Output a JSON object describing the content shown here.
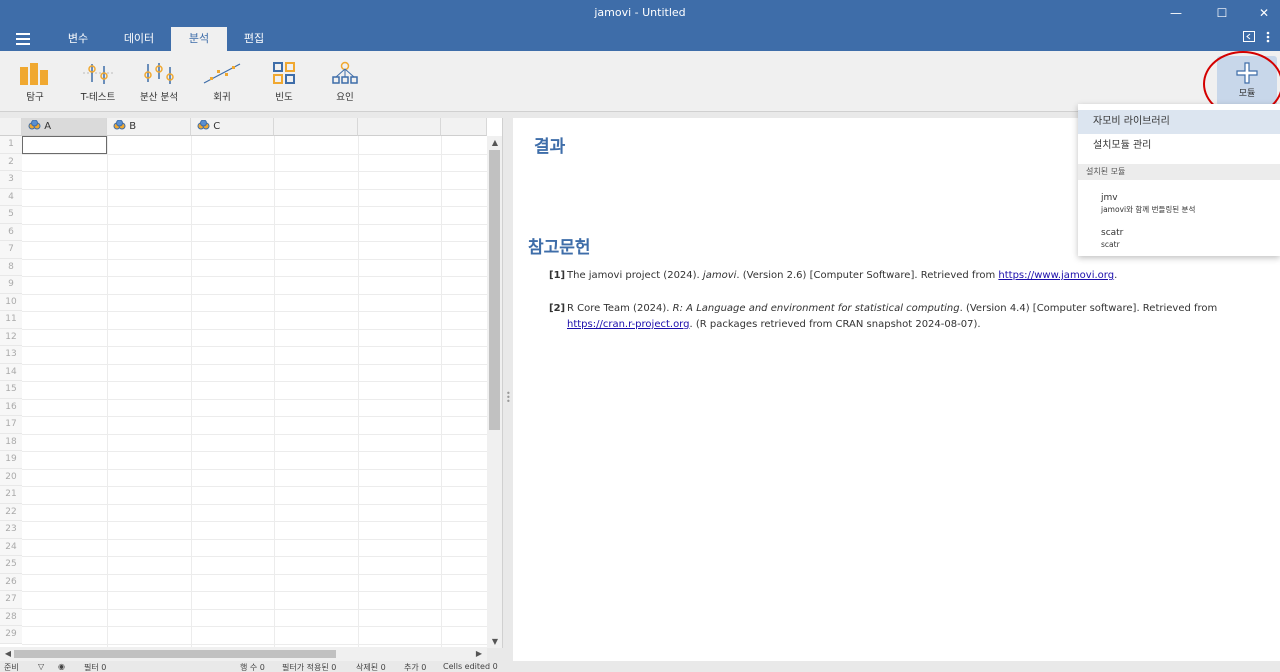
{
  "window": {
    "title": "jamovi - Untitled",
    "minimize": "—",
    "maximize": "☐",
    "close": "✕"
  },
  "tabs": [
    {
      "label": "변수"
    },
    {
      "label": "데이터"
    },
    {
      "label": "분석"
    },
    {
      "label": "편집"
    }
  ],
  "ribbon": {
    "explore": "탐구",
    "ttest": "T-테스트",
    "anova": "분산 분석",
    "regression": "회귀",
    "frequencies": "빈도",
    "factor": "요인",
    "modules": "모듈"
  },
  "sheet": {
    "columns": [
      "A",
      "B",
      "C"
    ],
    "rows": [
      "1",
      "2",
      "3",
      "4",
      "5",
      "6",
      "7",
      "8",
      "9",
      "10",
      "11",
      "12",
      "13",
      "14",
      "15",
      "16",
      "17",
      "18",
      "19",
      "20",
      "21",
      "22",
      "23",
      "24",
      "25",
      "26",
      "27",
      "28",
      "29"
    ]
  },
  "results": {
    "title": "결과",
    "references_title": "참고문헌",
    "ref1": {
      "num": "[1]",
      "pre": "The jamovi project (2024). ",
      "italic": "jamovi",
      "post": ". (Version 2.6) [Computer Software]. Retrieved from ",
      "link": "https://www.jamovi.org",
      "end": "."
    },
    "ref2": {
      "num": "[2]",
      "pre": "R Core Team (2024). ",
      "italic": "R: A Language and environment for statistical computing",
      "post": ". (Version 4.4) [Computer software]. Retrieved from ",
      "link": "https://cran.r-project.org",
      "end": ". (R packages retrieved from CRAN snapshot 2024-08-07)."
    }
  },
  "modules_menu": {
    "library": "자모비 라이브러리",
    "manage": "설치모듈 관리",
    "installed_header": "설치된 모듈",
    "installed": [
      {
        "name": "jmv",
        "desc": "jamovi와 함께 번들링된 분석"
      },
      {
        "name": "scatr",
        "desc": "scatr"
      }
    ]
  },
  "status": {
    "ready": "준비",
    "filter": "필터 0",
    "rows": "행 수 0",
    "filtered": "필터가 적용된 0",
    "deleted": "삭제된 0",
    "added": "추가 0",
    "edited": "Cells edited 0"
  },
  "colors": {
    "accent": "#3e6da9",
    "highlight": "#dce5f0",
    "annotation": "#d40000"
  }
}
